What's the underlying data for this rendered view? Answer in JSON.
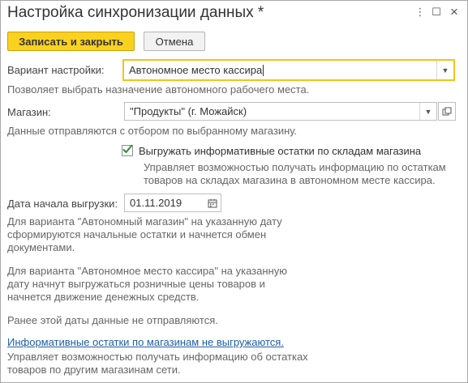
{
  "window": {
    "title": "Настройка синхронизации данных *",
    "more_icon": "⋮",
    "maximize_icon": "☐",
    "close_icon": "×"
  },
  "toolbar": {
    "save_close_label": "Записать и закрыть",
    "cancel_label": "Отмена"
  },
  "setting_variant": {
    "label": "Вариант настройки:",
    "value": "Автономное место кассира",
    "hint": "Позволяет выбрать назначение автономного рабочего места."
  },
  "store": {
    "label": "Магазин:",
    "value": "\"Продукты\" (г. Можайск)",
    "hint": "Данные отправляются с отбором по выбранному магазину."
  },
  "export_balances": {
    "checked": true,
    "label": "Выгружать информативные остатки по складам магазина",
    "hint": "Управляет возможностью получать информацию по остаткам\nтоваров на складах магазина в автономном месте кассира."
  },
  "start_date": {
    "label": "Дата начала выгрузки:",
    "value": "01.11.2019",
    "hint_store": "Для варианта \"Автономный магазин\" на указанную дату\nсформируются начальные остатки и начнется обмен\nдокументами.",
    "hint_cashier": "Для варианта \"Автономное место кассира\" на указанную\nдату начнут выгружаться розничные цены товаров и\nначнется движение денежных средств.",
    "hint_before": "Ранее этой даты данные не отправляются."
  },
  "other_stores": {
    "link": "Информативные остатки по магазинам не выгружаются.",
    "hint": "Управляет возможностью получать информацию об остатках\nтоваров по другим магазинам сети."
  },
  "colors": {
    "accent": "#fad11e",
    "focus_border": "#f5c318",
    "checkmark": "#2e8b2e",
    "link": "#1f5ea8"
  }
}
